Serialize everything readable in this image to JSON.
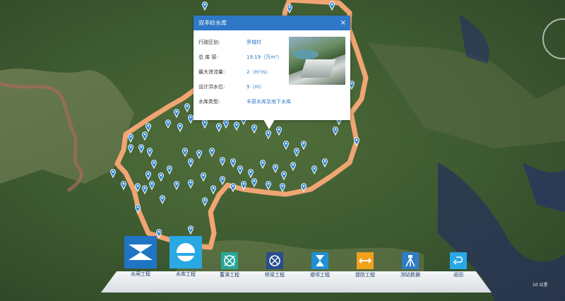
{
  "popup": {
    "title": "双丰岭水库",
    "close": "×",
    "rows": [
      {
        "label": "行政区划:",
        "value": "罗城村"
      },
      {
        "label": "总 库 容:",
        "value": "19.19（万m³）"
      },
      {
        "label": "最大泄流量:",
        "value": "2（m³/s）"
      },
      {
        "label": "设计洪水位:",
        "value": "9（m）"
      },
      {
        "label": "水库类型:",
        "value": "丰原水库及地下水库"
      }
    ]
  },
  "toolbar": {
    "items": [
      {
        "label": "水闸工程",
        "icon": "sluice-gate-icon",
        "color": "#1f74c4"
      },
      {
        "label": "水库工程",
        "icon": "reservoir-icon",
        "color": "#29a8e2"
      },
      {
        "label": "蓄滞工程",
        "icon": "detention-icon",
        "color": "#27a89a"
      },
      {
        "label": "桥梁工程",
        "icon": "bridge-icon",
        "color": "#2a4d8f"
      },
      {
        "label": "堤坝工程",
        "icon": "dam-icon",
        "color": "#1f8fd6"
      },
      {
        "label": "提防工程",
        "icon": "levee-icon",
        "color": "#f1a21c"
      },
      {
        "label": "测站数据",
        "icon": "station-icon",
        "color": "#2f7cc7"
      },
      {
        "label": "返回",
        "icon": "back-icon",
        "color": "#28a8e6"
      }
    ]
  },
  "map": {
    "compass": "compass-icon",
    "scale_text": "10 公里"
  }
}
